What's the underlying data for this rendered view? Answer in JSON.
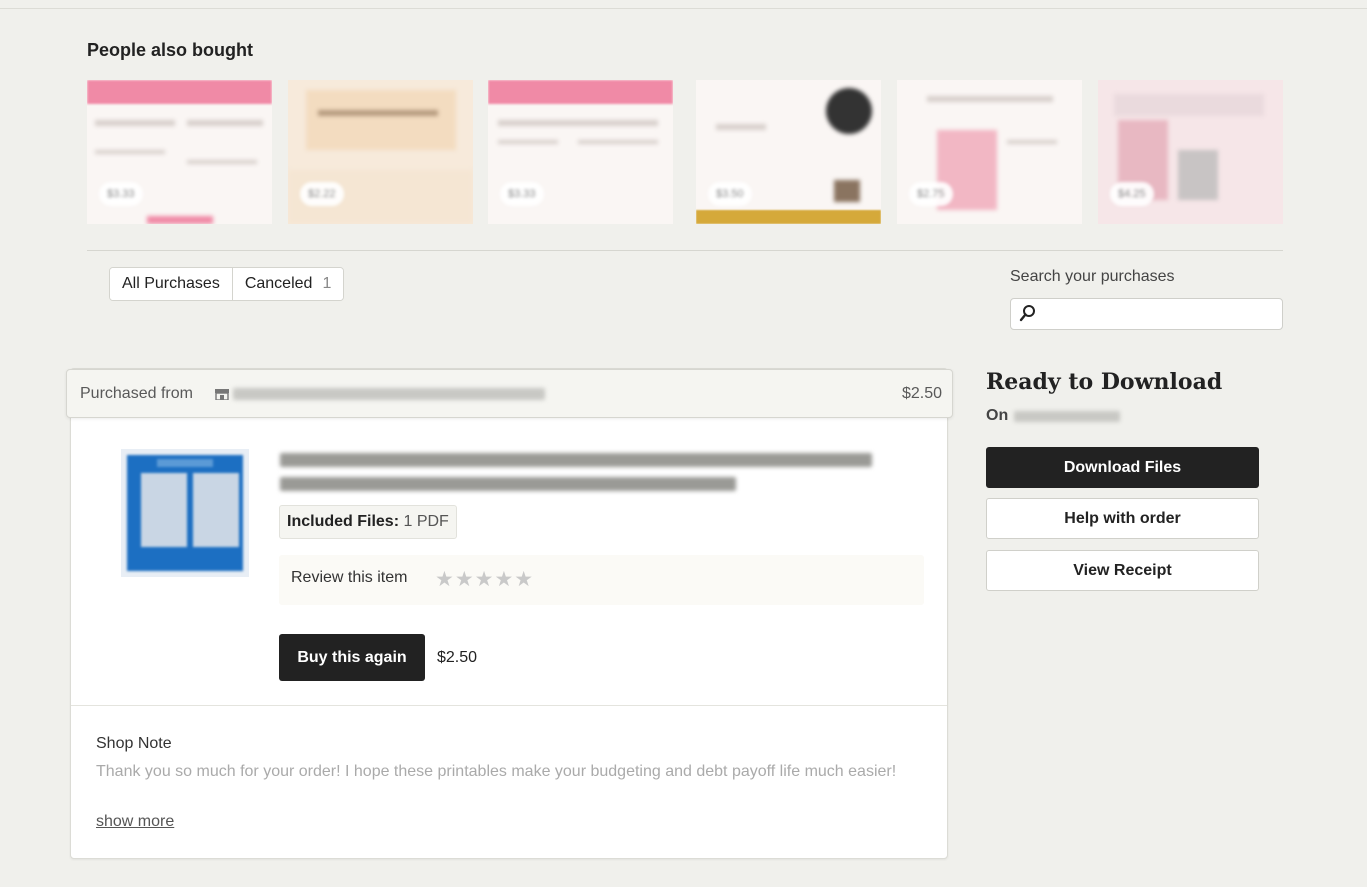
{
  "people_also_bought": {
    "title": "People also bought",
    "items": [
      {
        "price": "$3.33",
        "accent": "#f08aa6"
      },
      {
        "price": "$2.22",
        "accent": "#f3dcc0"
      },
      {
        "price": "$3.33",
        "accent": "#f08aa6"
      },
      {
        "price": "$3.50",
        "accent": "#d5a93a"
      },
      {
        "price": "$2.75",
        "accent": "#f2b7c4"
      },
      {
        "price": "$4.25",
        "accent": "#e8b8c2"
      }
    ]
  },
  "filters": {
    "all_label": "All Purchases",
    "canceled_label": "Canceled",
    "canceled_count": "1"
  },
  "search": {
    "label": "Search your purchases",
    "value": "",
    "placeholder": ""
  },
  "order": {
    "purchased_from_label": "Purchased from",
    "total": "$2.50",
    "included_files_label": "Included Files:",
    "included_files_value": "1 PDF",
    "review_label": "Review this item",
    "stars": "★★★★★",
    "buy_again_label": "Buy this again",
    "buy_again_price": "$2.50",
    "shop_note_title": "Shop Note",
    "shop_note_body": "Thank you so much for your order! I hope these printables make your budgeting and debt payoff life much easier!",
    "show_more_label": "show more"
  },
  "sidebar": {
    "ready_title": "Ready to Download",
    "on_label": "On",
    "download_label": "Download Files",
    "help_label": "Help with order",
    "receipt_label": "View Receipt"
  },
  "colors": {
    "background": "#f0f0ec",
    "primary_button": "#222222",
    "item_thumbnail": "#1c6fc2"
  }
}
